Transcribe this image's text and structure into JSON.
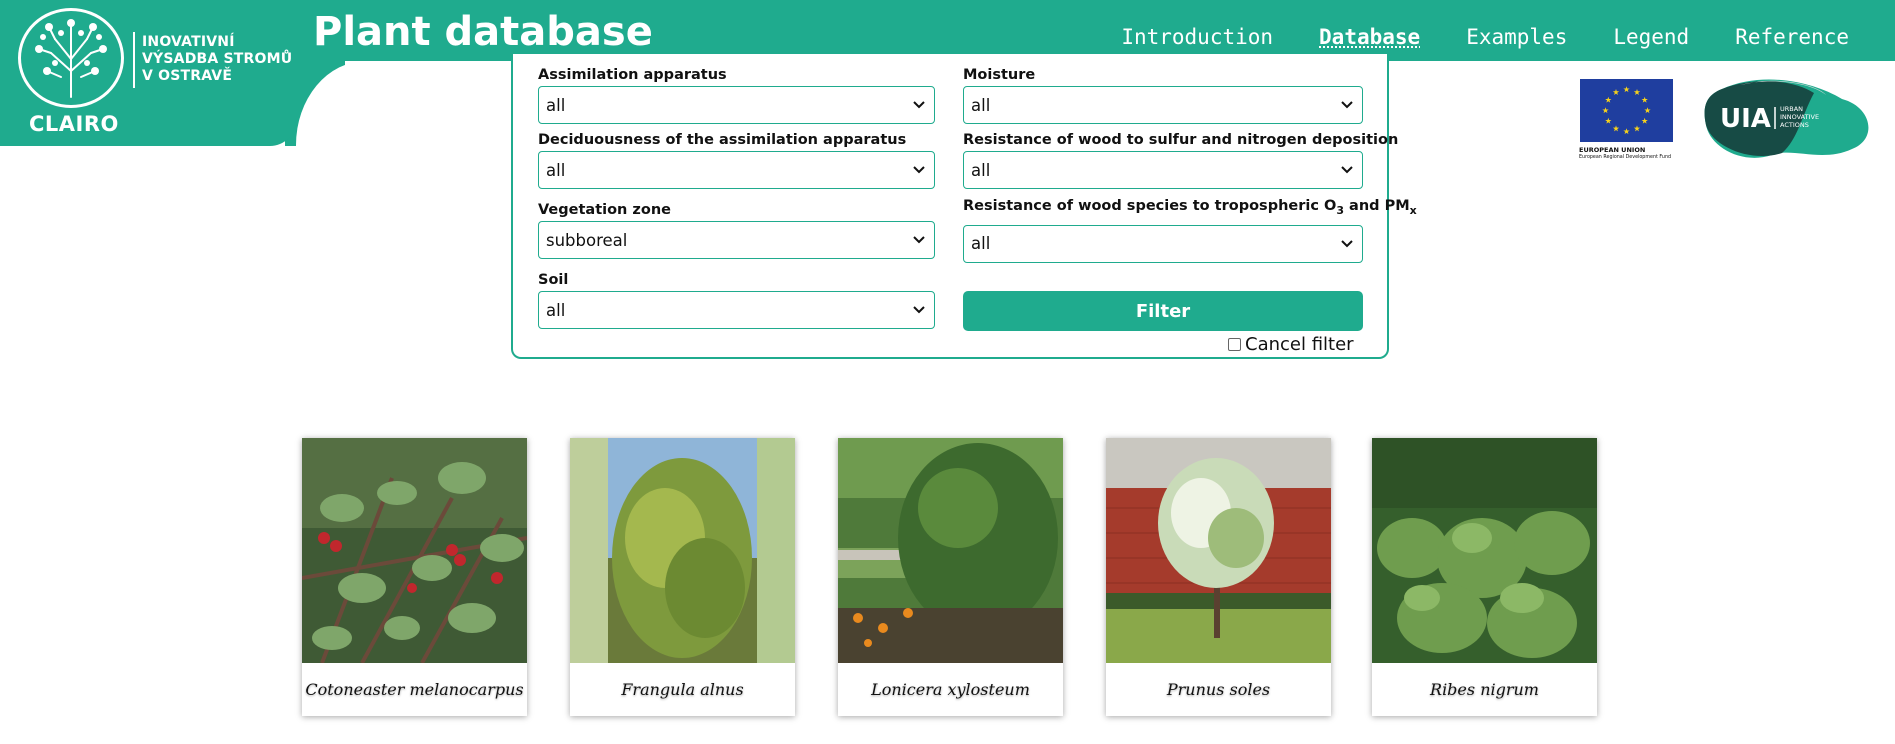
{
  "header": {
    "logo_lines": [
      "INOVATIVNÍ",
      "VÝSADBA STROMŮ",
      "V OSTRAVĚ"
    ],
    "logo_name": "CLAIRO",
    "title": "Plant database",
    "nav": [
      "Introduction",
      "Database",
      "Examples",
      "Legend",
      "Reference"
    ],
    "active_nav": "Database",
    "accent_color": "#1fab8e"
  },
  "filters": {
    "assimilation_apparatus": {
      "label": "Assimilation apparatus",
      "value": "all"
    },
    "deciduousness": {
      "label": "Deciduousness of the assimilation apparatus",
      "value": "all"
    },
    "vegetation_zone": {
      "label": "Vegetation zone",
      "value": "subboreal"
    },
    "soil": {
      "label": "Soil",
      "value": "all"
    },
    "moisture": {
      "label": "Moisture",
      "value": "all"
    },
    "sulfur_nitrogen": {
      "label": "Resistance of wood to sulfur and nitrogen deposition",
      "value": "all"
    },
    "ozone_pm": {
      "label_main": "Resistance of wood species to tropospheric O",
      "label_sub1": "3",
      "label_mid": " and PM",
      "label_sub2": "x",
      "value": "all"
    },
    "filter_button": "Filter",
    "cancel_filter": "Cancel filter",
    "cancel_checked": false
  },
  "partners": {
    "eu_line1": "EUROPEAN UNION",
    "eu_line2": "European Regional Development Fund",
    "uia_mark": "UIA",
    "uia_lines": [
      "URBAN",
      "INNOVATIVE",
      "ACTIONS"
    ]
  },
  "plants": [
    {
      "name": "Cotoneaster melanocarpus",
      "image": "cotoneaster-photo"
    },
    {
      "name": "Frangula alnus",
      "image": "frangula-photo"
    },
    {
      "name": "Lonicera xylosteum",
      "image": "lonicera-photo"
    },
    {
      "name": "Prunus soles",
      "image": "prunus-photo"
    },
    {
      "name": "Ribes nigrum",
      "image": "ribes-photo"
    }
  ]
}
